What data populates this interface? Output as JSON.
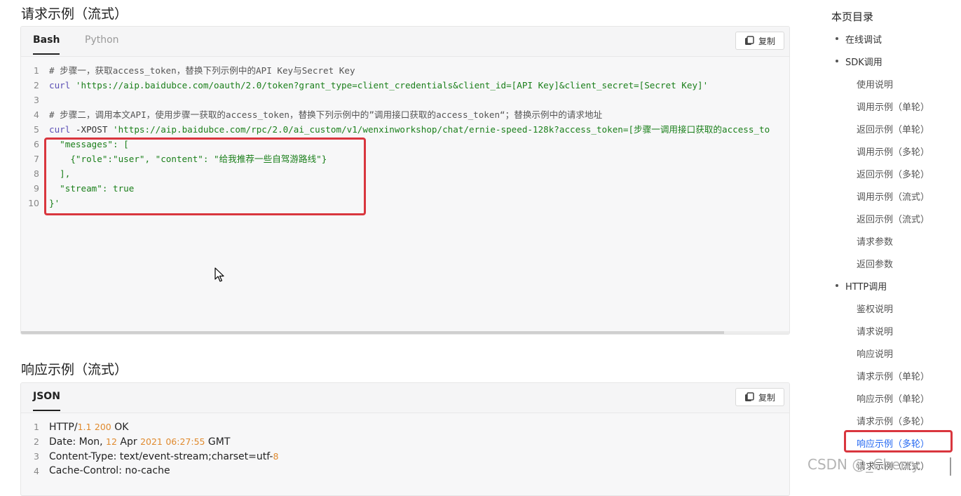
{
  "request_section": {
    "title": "请求示例（流式）",
    "tabs": [
      "Bash",
      "Python"
    ],
    "copy_label": "复制",
    "lines": [
      {
        "n": "1",
        "segments": [
          {
            "t": "# 步骤一，获取access_token，替换下列示例中的API Key与Secret Key",
            "c": "c-comment"
          }
        ]
      },
      {
        "n": "2",
        "segments": [
          {
            "t": "curl ",
            "c": "c-cmd"
          },
          {
            "t": "'https://aip.baidubce.com/oauth/2.0/token?grant_type=client_credentials&client_id=[API Key]&client_secret=[Secret Key]'",
            "c": "c-str"
          }
        ]
      },
      {
        "n": "3",
        "segments": []
      },
      {
        "n": "4",
        "segments": [
          {
            "t": "# 步骤二，调用本文API，使用步骤一获取的access_token，替换下列示例中的”调用接口获取的access_token“；替换示例中的请求地址",
            "c": "c-comment"
          }
        ]
      },
      {
        "n": "5",
        "segments": [
          {
            "t": "curl ",
            "c": "c-cmd"
          },
          {
            "t": "-XPOST ",
            "c": "c-plain"
          },
          {
            "t": "'https://aip.baidubce.com/rpc/2.0/ai_custom/v1/wenxinworkshop/chat/ernie-speed-128k?access_token=[步骤一调用接口获取的access_to",
            "c": "c-str"
          }
        ]
      },
      {
        "n": "6",
        "segments": [
          {
            "t": "  \"messages\": [",
            "c": "c-str"
          }
        ]
      },
      {
        "n": "7",
        "segments": [
          {
            "t": "    {\"role\":\"user\", \"content\": \"给我推荐一些自驾游路线\"}",
            "c": "c-str"
          }
        ]
      },
      {
        "n": "8",
        "segments": [
          {
            "t": "  ],",
            "c": "c-str"
          }
        ]
      },
      {
        "n": "9",
        "segments": [
          {
            "t": "  \"stream\": true",
            "c": "c-str"
          }
        ]
      },
      {
        "n": "10",
        "segments": [
          {
            "t": "}'",
            "c": "c-str"
          }
        ]
      }
    ]
  },
  "response_section": {
    "title": "响应示例（流式）",
    "tabs": [
      "JSON"
    ],
    "copy_label": "复制",
    "lines": [
      {
        "n": "1",
        "segments": [
          {
            "t": "HTTP/",
            "c": ""
          },
          {
            "t": "1.1",
            "c": "num"
          },
          {
            "t": " ",
            "c": ""
          },
          {
            "t": "200",
            "c": "num"
          },
          {
            "t": " OK",
            "c": ""
          }
        ]
      },
      {
        "n": "2",
        "segments": [
          {
            "t": "Date: Mon, ",
            "c": ""
          },
          {
            "t": "12",
            "c": "num"
          },
          {
            "t": " Apr ",
            "c": ""
          },
          {
            "t": "2021",
            "c": "num"
          },
          {
            "t": " ",
            "c": ""
          },
          {
            "t": "06:27:55",
            "c": "num"
          },
          {
            "t": " GMT",
            "c": ""
          }
        ]
      },
      {
        "n": "3",
        "segments": [
          {
            "t": "Content-Type: text/event-stream;charset=utf-",
            "c": ""
          },
          {
            "t": "8",
            "c": "num"
          }
        ]
      },
      {
        "n": "4",
        "segments": [
          {
            "t": "Cache-Control: no-cache",
            "c": ""
          }
        ]
      }
    ]
  },
  "toc": {
    "title": "本页目录",
    "items": [
      {
        "label": "在线调试",
        "level": 1
      },
      {
        "label": "SDK调用",
        "level": 1
      },
      {
        "label": "使用说明",
        "level": 2
      },
      {
        "label": "调用示例（单轮）",
        "level": 2
      },
      {
        "label": "返回示例（单轮）",
        "level": 2
      },
      {
        "label": "调用示例（多轮）",
        "level": 2
      },
      {
        "label": "返回示例（多轮）",
        "level": 2
      },
      {
        "label": "调用示例（流式）",
        "level": 2
      },
      {
        "label": "返回示例（流式）",
        "level": 2
      },
      {
        "label": "请求参数",
        "level": 2
      },
      {
        "label": "返回参数",
        "level": 2
      },
      {
        "label": "HTTP调用",
        "level": 1
      },
      {
        "label": "鉴权说明",
        "level": 2
      },
      {
        "label": "请求说明",
        "level": 2
      },
      {
        "label": "响应说明",
        "level": 2
      },
      {
        "label": "请求示例（单轮）",
        "level": 2
      },
      {
        "label": "响应示例（单轮）",
        "level": 2
      },
      {
        "label": "请求示例（多轮）",
        "level": 2
      },
      {
        "label": "响应示例（多轮）",
        "level": 2,
        "active": true
      },
      {
        "label": "请求示例（流式）",
        "level": 2
      }
    ]
  },
  "watermark": "CSDN @_Cherry",
  "colors": {
    "accent": "#2468f2",
    "highlight_box": "#d9363e",
    "string": "#1a7f1a",
    "command": "#5b4fb5",
    "number": "#e08a2e"
  }
}
